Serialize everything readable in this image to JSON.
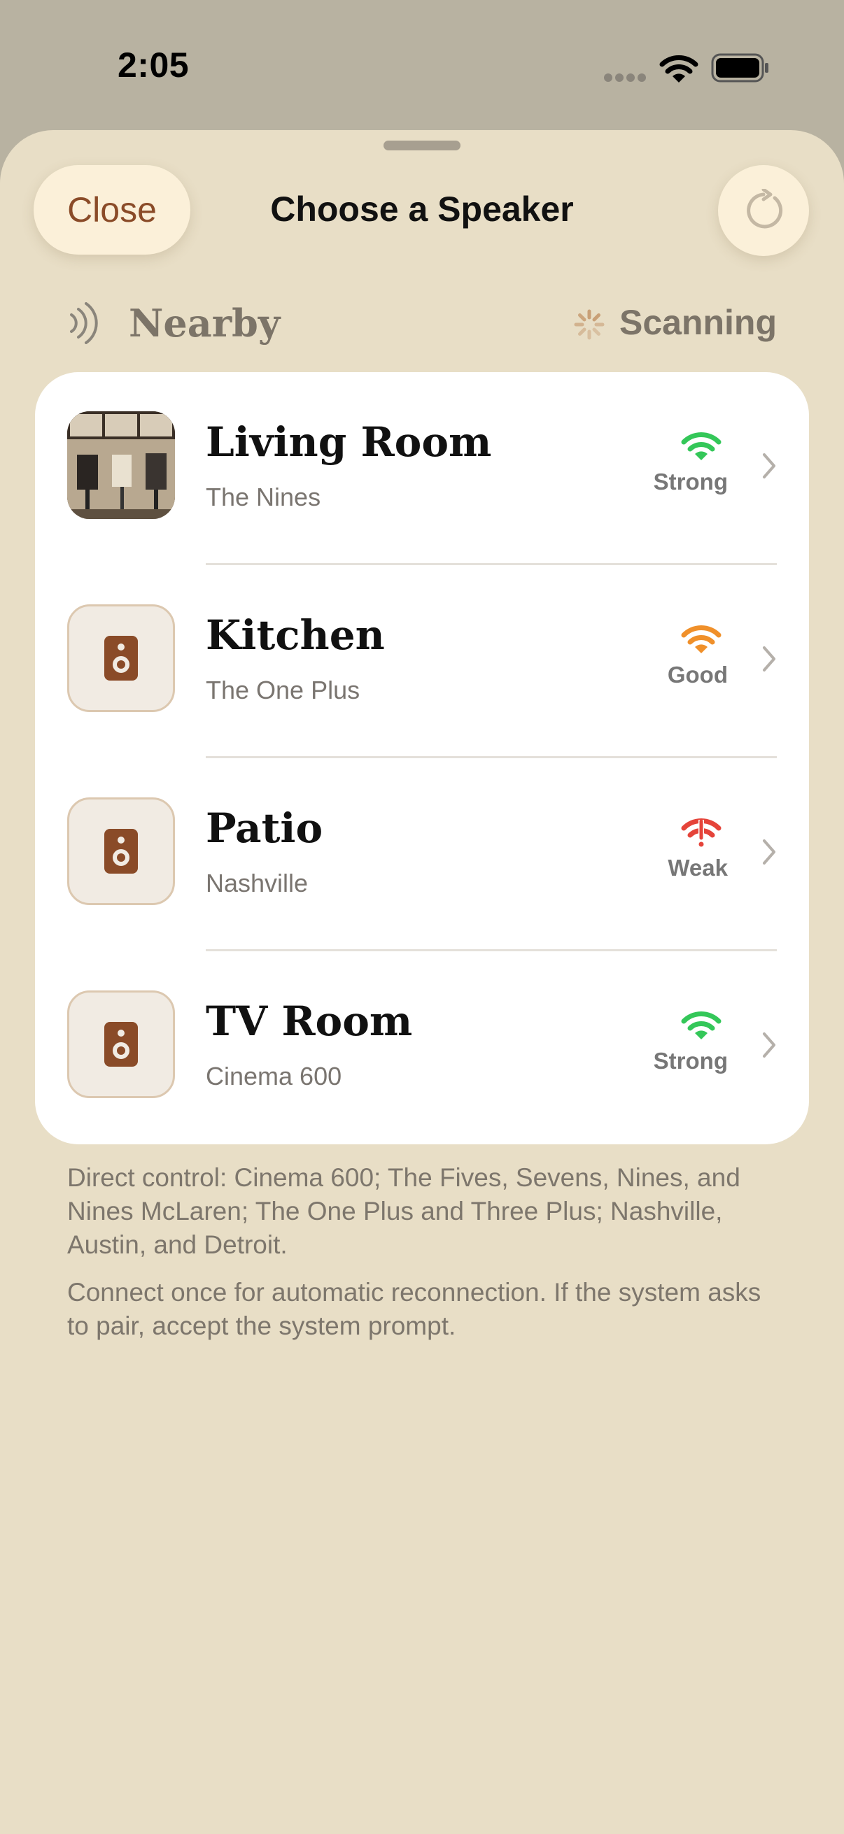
{
  "status_bar": {
    "time": "2:05"
  },
  "sheet": {
    "close_label": "Close",
    "title": "Choose a Speaker"
  },
  "section": {
    "label": "Nearby",
    "status": "Scanning"
  },
  "speakers": [
    {
      "name": "Living Room",
      "model": "The Nines",
      "signal": "Strong",
      "signal_color": "#34c759",
      "icon": "speaker-photo"
    },
    {
      "name": "Kitchen",
      "model": "The One Plus",
      "signal": "Good",
      "signal_color": "#f0902a",
      "icon": "speaker-icon"
    },
    {
      "name": "Patio",
      "model": "Nashville",
      "signal": "Weak",
      "signal_color": "#e5443a",
      "icon": "speaker-icon"
    },
    {
      "name": "TV Room",
      "model": "Cinema 600",
      "signal": "Strong",
      "signal_color": "#34c759",
      "icon": "speaker-icon"
    }
  ],
  "footer": {
    "compat": "Direct control: Cinema 600; The Fives, Sevens, Nines, and Nines McLaren; The One Plus and Three Plus; Nashville, Austin, and Detroit.",
    "hint": "Connect once for automatic reconnection. If the system asks to pair, accept the system prompt."
  },
  "colors": {
    "accent": "#8a4b28",
    "background": "#e8dec6",
    "button_bg": "#fbf0d9"
  }
}
